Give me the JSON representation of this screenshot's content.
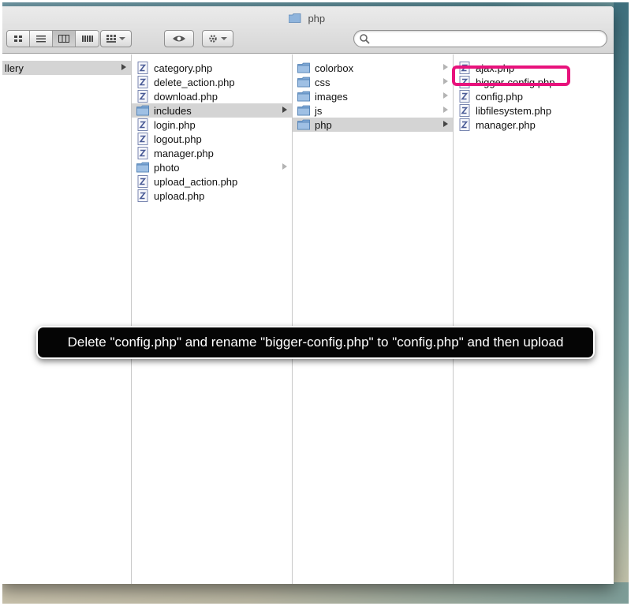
{
  "window": {
    "title": "php"
  },
  "search": {
    "placeholder": ""
  },
  "columns": [
    {
      "items": [
        {
          "label": "llery",
          "icon": "none",
          "selected": true,
          "arrow": true
        }
      ]
    },
    {
      "items": [
        {
          "label": "category.php",
          "icon": "php-file-icon"
        },
        {
          "label": "delete_action.php",
          "icon": "php-file-icon"
        },
        {
          "label": "download.php",
          "icon": "php-file-icon"
        },
        {
          "label": "includes",
          "icon": "folder-icon",
          "selected": true,
          "arrow": true
        },
        {
          "label": "login.php",
          "icon": "php-file-icon"
        },
        {
          "label": "logout.php",
          "icon": "php-file-icon"
        },
        {
          "label": "manager.php",
          "icon": "php-file-icon"
        },
        {
          "label": "photo",
          "icon": "folder-icon",
          "arrow": true
        },
        {
          "label": "upload_action.php",
          "icon": "php-file-icon"
        },
        {
          "label": "upload.php",
          "icon": "php-file-icon"
        }
      ]
    },
    {
      "items": [
        {
          "label": "colorbox",
          "icon": "folder-icon",
          "arrow": true
        },
        {
          "label": "css",
          "icon": "folder-icon",
          "arrow": true
        },
        {
          "label": "images",
          "icon": "folder-icon",
          "arrow": true
        },
        {
          "label": "js",
          "icon": "folder-icon",
          "arrow": true
        },
        {
          "label": "php",
          "icon": "folder-icon",
          "selected": true,
          "arrow": true
        }
      ]
    },
    {
      "items": [
        {
          "label": "ajax.php",
          "icon": "php-file-icon"
        },
        {
          "label": "bigger-config.php",
          "icon": "php-file-icon"
        },
        {
          "label": "config.php",
          "icon": "php-file-icon"
        },
        {
          "label": "libfilesystem.php",
          "icon": "php-file-icon"
        },
        {
          "label": "manager.php",
          "icon": "php-file-icon"
        }
      ]
    }
  ],
  "callout": {
    "text": "Delete \"config.php\" and rename \"bigger-config.php\" to \"config.php\" and then upload"
  },
  "colors": {
    "highlight": "#e8127c",
    "selection": "#d4d4d4",
    "callout_bg": "#050505"
  }
}
